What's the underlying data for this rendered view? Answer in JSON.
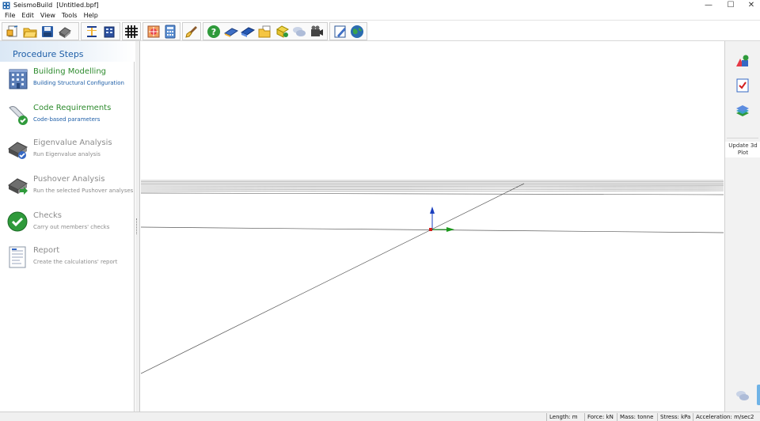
{
  "window": {
    "app_name": "SeismoBuild",
    "document": "[Untitled.bpf]",
    "minimize": "—",
    "maximize": "☐",
    "close": "✕"
  },
  "menu": {
    "items": [
      "File",
      "Edit",
      "View",
      "Tools",
      "Help"
    ]
  },
  "toolbar": {
    "icons": [
      "new-project-icon",
      "open-folder-icon",
      "save-disk-icon",
      "settings-machine-icon",
      "section-profile-icon",
      "building-import-icon",
      "structural-grid-icon",
      "toolbox-icon",
      "calculator-icon",
      "brush-icon",
      "help-icon",
      "manual-book-icon",
      "tutorial-book-icon",
      "documents-icon",
      "faq-icon",
      "chat-icon",
      "video-camera-icon",
      "edit-notes-icon",
      "globe-icon"
    ]
  },
  "procedure": {
    "title": "Procedure Steps",
    "steps": [
      {
        "title": "Building Modelling",
        "subtitle": "Building Structural Configuration",
        "icon": "building-icon",
        "active": true
      },
      {
        "title": "Code Requirements",
        "subtitle": "Code-based parameters",
        "icon": "code-scroll-check-icon",
        "active": true
      },
      {
        "title": "Eigenvalue Analysis",
        "subtitle": "Run Eigenvalue analysis",
        "icon": "eigenvalue-machine-icon",
        "active": false
      },
      {
        "title": "Pushover Analysis",
        "subtitle": "Run the selected Pushover analyses",
        "icon": "pushover-machine-icon",
        "active": false
      },
      {
        "title": "Checks",
        "subtitle": "Carry out members' checks",
        "icon": "check-circle-icon",
        "active": false
      },
      {
        "title": "Report",
        "subtitle": "Create the calculations' report",
        "icon": "report-document-icon",
        "active": false
      }
    ]
  },
  "right_panel": {
    "icons": [
      "shapes-3d-icon",
      "checklist-icon",
      "layers-icon"
    ],
    "update_label": "Update 3d",
    "update_label_2": "Plot",
    "bottom_icon": "chat-bubbles-icon"
  },
  "status": {
    "length": "Length: m",
    "force": "Force: kN",
    "mass": "Mass: tonne",
    "stress": "Stress: kPa",
    "acceleration": "Acceleration: m/sec2"
  },
  "colors": {
    "accent_blue": "#1f5fa8",
    "active_green": "#2e8b2e",
    "inactive_gray": "#8c8c8c",
    "axis_z": "#1a3fbf",
    "axis_y": "#1a9a1a",
    "origin": "#d21e1e"
  }
}
